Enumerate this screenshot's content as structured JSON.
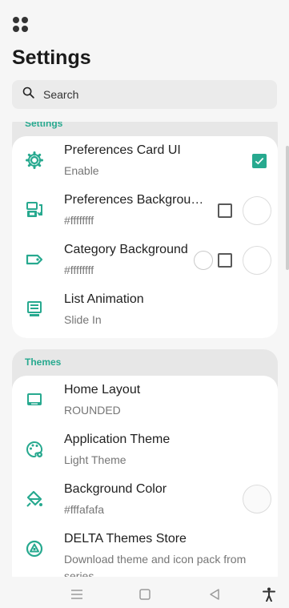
{
  "header": {
    "apps_icon": "apps-grid-icon",
    "title": "Settings"
  },
  "search": {
    "placeholder": "Search",
    "icon": "search-icon"
  },
  "sections": [
    {
      "header": "Settings",
      "items": [
        {
          "title": "Preferences Card UI",
          "subtitle": "Enable",
          "icon": "gear-icon",
          "checked": true
        },
        {
          "title": "Preferences Backgrou…",
          "subtitle": "#ffffffff",
          "icon": "layout-swap-icon",
          "checked": false
        },
        {
          "title": "Category Background",
          "subtitle": "#ffffffff",
          "icon": "label-tag-icon",
          "checked": false
        },
        {
          "title": "List Animation",
          "subtitle": "Slide In",
          "icon": "list-animation-icon"
        }
      ]
    },
    {
      "header": "Themes",
      "items": [
        {
          "title": "Home Layout",
          "subtitle": "ROUNDED",
          "icon": "monitor-icon"
        },
        {
          "title": "Application Theme",
          "subtitle": "Light Theme",
          "icon": "palette-icon"
        },
        {
          "title": "Background Color",
          "subtitle": "#fffafafa",
          "icon": "paint-bucket-icon"
        },
        {
          "title": "DELTA Themes Store",
          "subtitle": "Download theme and icon pack from",
          "subtitle_cont": "series",
          "icon": "delta-store-icon"
        }
      ]
    }
  ],
  "navbar": {
    "buttons": [
      "menu-icon",
      "home-icon",
      "back-icon",
      "accessibility-icon"
    ]
  },
  "colors": {
    "accent": "#27a98f",
    "background": "#f6f6f6",
    "card": "#ffffff",
    "section_bg": "#e7e7e7"
  }
}
